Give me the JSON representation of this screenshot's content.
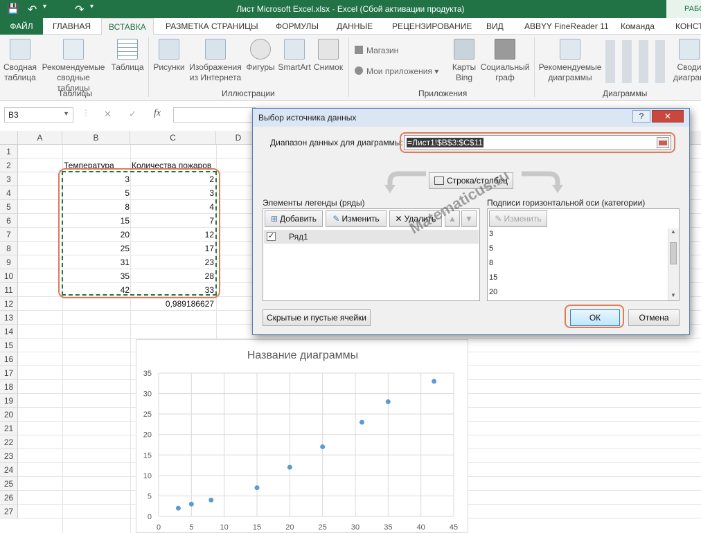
{
  "titlebar": {
    "title": "Лист Microsoft Excel.xlsx - Excel (Сбой активации продукта)",
    "badge": "РАБО"
  },
  "tabs": [
    "ФАЙЛ",
    "ГЛАВНАЯ",
    "ВСТАВКА",
    "РАЗМЕТКА СТРАНИЦЫ",
    "ФОРМУЛЫ",
    "ДАННЫЕ",
    "РЕЦЕНЗИРОВАНИЕ",
    "ВИД",
    "ABBYY FineReader 11",
    "Команда",
    "КОНСТ"
  ],
  "ribbon": {
    "tables": {
      "pivot": "Сводная таблица",
      "recommended_pivot": "Рекомендуемые сводные таблицы",
      "table": "Таблица",
      "group": "Таблицы"
    },
    "illustrations": {
      "pictures": "Рисунки",
      "online_pictures": "Изображения из Интернета",
      "shapes": "Фигуры",
      "smartart": "SmartArt",
      "screenshot": "Снимок",
      "group": "Иллюстрации"
    },
    "apps": {
      "store": "Магазин",
      "my_apps": "Мои приложения",
      "bing": "Карты Bing",
      "social": "Социальный граф",
      "group": "Приложения"
    },
    "charts": {
      "recommended": "Рекомендуемые диаграммы",
      "pivot_chart": "Своди диаграм",
      "group": "Диаграммы"
    }
  },
  "formula_bar": {
    "name_box": "B3",
    "fx": "fx"
  },
  "columns": [
    "A",
    "B",
    "C",
    "D"
  ],
  "rows": [
    "1",
    "2",
    "3",
    "4",
    "5",
    "6",
    "7",
    "8",
    "9",
    "10",
    "11",
    "12",
    "13",
    "14",
    "15",
    "16",
    "17",
    "18",
    "19",
    "20",
    "21",
    "22",
    "23",
    "24",
    "25",
    "26",
    "27"
  ],
  "sheet": {
    "header_b": "Температура",
    "header_c": "Количества пожаров",
    "b_values": [
      "3",
      "5",
      "8",
      "15",
      "20",
      "25",
      "31",
      "35",
      "42"
    ],
    "c_values": [
      "2",
      "3",
      "4",
      "7",
      "12",
      "17",
      "23",
      "28",
      "33"
    ],
    "correl": "0,989186627"
  },
  "dialog": {
    "title": "Выбор источника данных",
    "range_label": "Диапазон данных для диаграммы:",
    "range_value": "=Лист1!$B$3:$C$11",
    "switch_button": "Строка/столбец",
    "legend_label": "Элементы легенды (ряды)",
    "add": "Добавить",
    "edit": "Изменить",
    "delete": "Удалить",
    "series": [
      "Ряд1"
    ],
    "axis_label": "Подписи горизонтальной оси (категории)",
    "axis_edit": "Изменить",
    "axis_items": [
      "3",
      "5",
      "8",
      "15",
      "20"
    ],
    "hidden_cells": "Скрытые и пустые ячейки",
    "ok": "ОК",
    "cancel": "Отмена",
    "watermark": "Matematicus.ru"
  },
  "chart_data": {
    "type": "scatter",
    "title": "Название диаграммы",
    "x": [
      3,
      5,
      8,
      15,
      20,
      25,
      31,
      35,
      42
    ],
    "y": [
      2,
      3,
      4,
      7,
      12,
      17,
      23,
      28,
      33
    ],
    "xlim": [
      0,
      45
    ],
    "ylim": [
      0,
      35
    ],
    "xticks": [
      0,
      5,
      10,
      15,
      20,
      25,
      30,
      35,
      40,
      45
    ],
    "yticks": [
      0,
      5,
      10,
      15,
      20,
      25,
      30,
      35
    ],
    "grid": true,
    "color": "#5b9bd5"
  },
  "colors": {
    "excel_green": "#217346",
    "highlight": "#e07b58",
    "marker": "#5b9bd5"
  }
}
